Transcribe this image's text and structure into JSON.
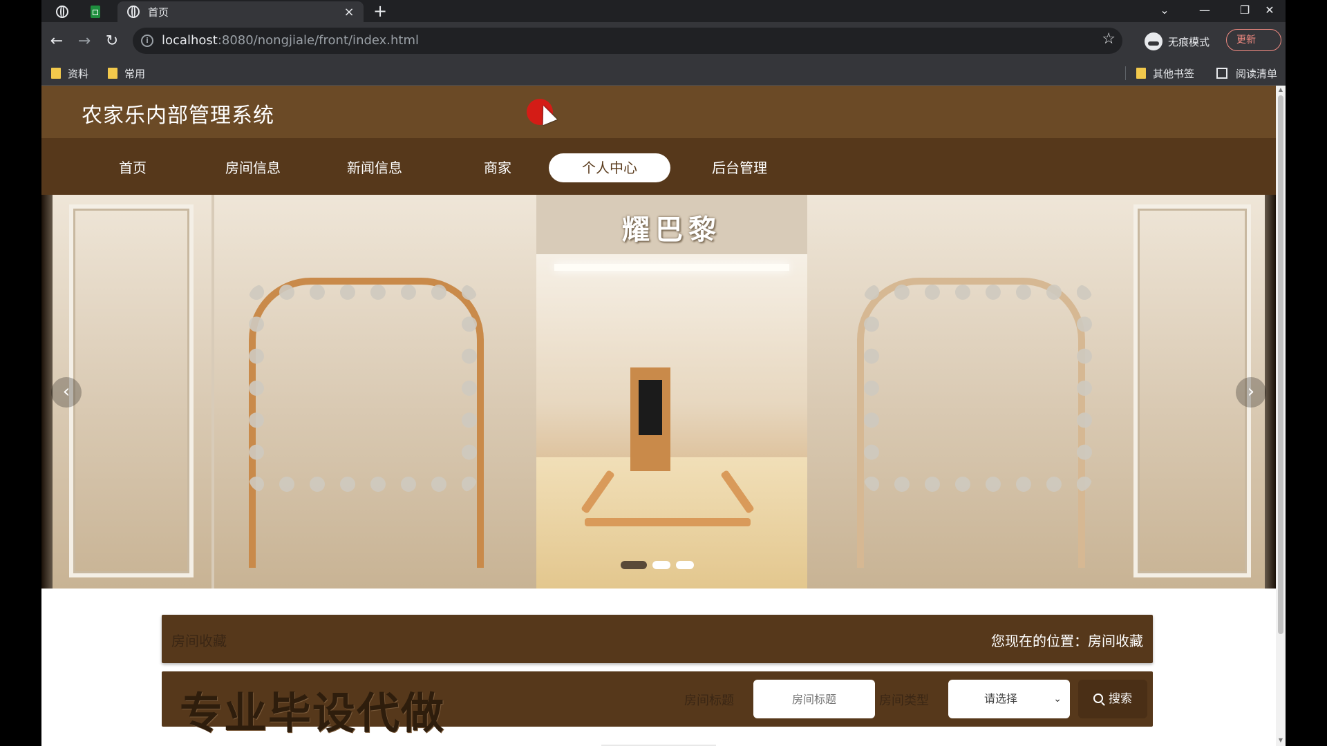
{
  "browser": {
    "tab_title": "首页",
    "tab_close": "×",
    "new_tab": "+",
    "url_host": "localhost",
    "url_rest": ":8080/nongjiale/front/index.html",
    "incognito_label": "无痕模式",
    "update_label": "更新",
    "bookmarks": [
      "资料",
      "常用"
    ],
    "other_bookmarks": "其他书签",
    "reading_list": "阅读清单"
  },
  "site": {
    "title": "农家乐内部管理系统",
    "nav": [
      {
        "label": "首页",
        "active": false
      },
      {
        "label": "房间信息",
        "active": false
      },
      {
        "label": "新闻信息",
        "active": false
      },
      {
        "label": "商家",
        "active": false
      },
      {
        "label": "个人中心",
        "active": true
      },
      {
        "label": "后台管理",
        "active": false
      }
    ]
  },
  "banner": {
    "sign_text": "耀巴黎",
    "slide_count": 3,
    "active_slide": 1,
    "prev": "‹",
    "next": "›"
  },
  "breadcrumb": {
    "left": "房间收藏",
    "right": "您现在的位置：房间收藏"
  },
  "search": {
    "watermark": "专业毕设代做",
    "title_label": "房间标题",
    "title_placeholder": "房间标题",
    "type_label": "房间类型",
    "type_selected": "请选择",
    "button_label": "搜索"
  },
  "colors": {
    "header": "#6b4a26",
    "nav": "#56381b",
    "accent_text": "#5a3b1c"
  }
}
